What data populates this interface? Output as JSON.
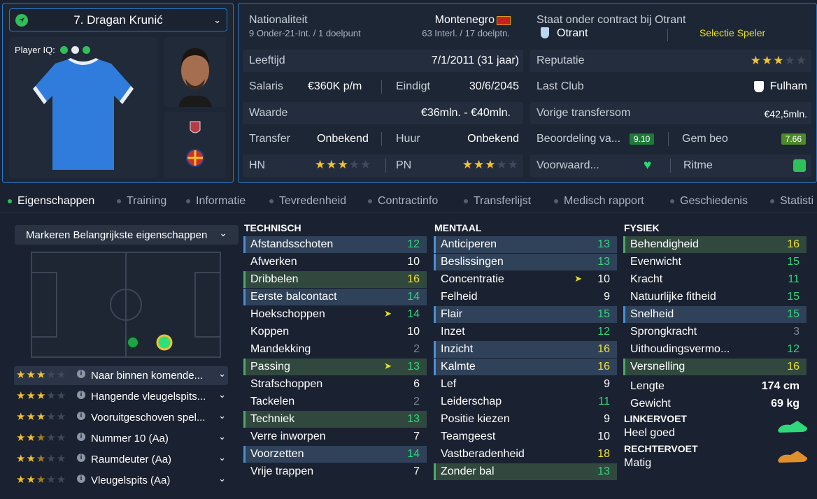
{
  "player": {
    "name": "7. Dragan Krunić",
    "iq_label": "Player IQ:"
  },
  "info": {
    "nationality_label": "Nationaliteit",
    "nationality": "Montenegro",
    "youth_caps": "9 Onder-21-Int. / 1 doelpunt",
    "caps": "63 Interl. / 17 doelptn.",
    "contract_label": "Staat onder contract bij Otrant",
    "club": "Otrant",
    "squad_label": "Selectie Speler",
    "age_label": "Leeftijd",
    "age": "7/1/2011 (31 jaar)",
    "rep_label": "Reputatie",
    "salary_label": "Salaris",
    "salary": "€360K p/m",
    "ends_label": "Eindigt",
    "ends": "30/6/2045",
    "lastclub_label": "Last Club",
    "lastclub": "Fulham",
    "value_label": "Waarde",
    "value": "€36mln. - €40mln.",
    "prevfee_label": "Vorige transfersom",
    "prevfee": "€42,5mln.",
    "transfer_label": "Transfer",
    "transfer": "Onbekend",
    "loan_label": "Huur",
    "loan": "Onbekend",
    "rating_label": "Beoordeling va...",
    "rating": "9.10",
    "avg_label": "Gem beo",
    "avg": "7.66",
    "hn_label": "HN",
    "pn_label": "PN",
    "cond_label": "Voorwaard...",
    "sharp_label": "Ritme"
  },
  "tabs": [
    "Eigenschappen",
    "Training",
    "Informatie",
    "Tevredenheid",
    "Contractinfo",
    "Transferlijst",
    "Medisch rapport",
    "Geschiedenis",
    "Statisti"
  ],
  "position_select": "Markeren Belangrijkste eigenschappen",
  "roles": [
    {
      "name": "Naar binnen komende...",
      "stars": 3
    },
    {
      "name": "Hangende vleugelspits...",
      "stars": 3
    },
    {
      "name": "Vooruitgeschoven spel...",
      "stars": 3
    },
    {
      "name": "Nummer 10 (Aa)",
      "stars": 2.5
    },
    {
      "name": "Raumdeuter (Aa)",
      "stars": 2.5
    },
    {
      "name": "Vleugelspits (Aa)",
      "stars": 2.5
    }
  ],
  "technical": {
    "title": "TECHNISCH",
    "attrs": [
      {
        "n": "Afstandsschoten",
        "v": "12"
      },
      {
        "n": "Afwerken",
        "v": "10"
      },
      {
        "n": "Dribbelen",
        "v": "16"
      },
      {
        "n": "Eerste balcontact",
        "v": "14"
      },
      {
        "n": "Hoekschoppen",
        "v": "14"
      },
      {
        "n": "Koppen",
        "v": "10"
      },
      {
        "n": "Mandekking",
        "v": "2"
      },
      {
        "n": "Passing",
        "v": "13"
      },
      {
        "n": "Strafschoppen",
        "v": "6"
      },
      {
        "n": "Tackelen",
        "v": "2"
      },
      {
        "n": "Techniek",
        "v": "13"
      },
      {
        "n": "Verre inworpen",
        "v": "7"
      },
      {
        "n": "Voorzetten",
        "v": "14"
      },
      {
        "n": "Vrije trappen",
        "v": "7"
      }
    ]
  },
  "mental": {
    "title": "MENTAAL",
    "attrs": [
      {
        "n": "Anticiperen",
        "v": "13"
      },
      {
        "n": "Beslissingen",
        "v": "13"
      },
      {
        "n": "Concentratie",
        "v": "10"
      },
      {
        "n": "Felheid",
        "v": "9"
      },
      {
        "n": "Flair",
        "v": "15"
      },
      {
        "n": "Inzet",
        "v": "12"
      },
      {
        "n": "Inzicht",
        "v": "16"
      },
      {
        "n": "Kalmte",
        "v": "16"
      },
      {
        "n": "Lef",
        "v": "9"
      },
      {
        "n": "Leiderschap",
        "v": "11"
      },
      {
        "n": "Positie kiezen",
        "v": "9"
      },
      {
        "n": "Teamgeest",
        "v": "10"
      },
      {
        "n": "Vastberadenheid",
        "v": "18"
      },
      {
        "n": "Zonder bal",
        "v": "13"
      }
    ]
  },
  "physical": {
    "title": "FYSIEK",
    "attrs": [
      {
        "n": "Behendigheid",
        "v": "16"
      },
      {
        "n": "Evenwicht",
        "v": "15"
      },
      {
        "n": "Kracht",
        "v": "11"
      },
      {
        "n": "Natuurlijke fitheid",
        "v": "15"
      },
      {
        "n": "Snelheid",
        "v": "15"
      },
      {
        "n": "Sprongkracht",
        "v": "3"
      },
      {
        "n": "Uithoudingsvermo...",
        "v": "12"
      },
      {
        "n": "Versnelling",
        "v": "16"
      },
      {
        "n": "Lengte",
        "v": "174 cm"
      },
      {
        "n": "Gewicht",
        "v": "69 kg"
      }
    ]
  },
  "feet": {
    "left_label": "LINKERVOET",
    "left": "Heel goed",
    "right_label": "RECHTERVOET",
    "right": "Matig"
  }
}
